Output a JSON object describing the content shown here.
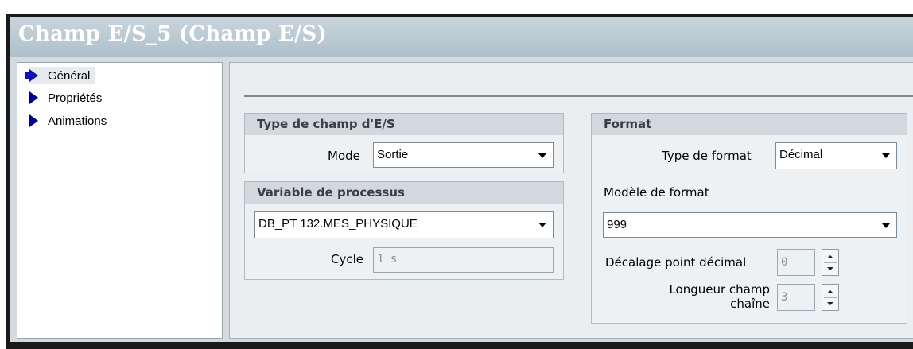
{
  "window": {
    "title": "Champ E/S_5 (Champ E/S)"
  },
  "sidebar": {
    "items": [
      {
        "label": "Général",
        "active": true
      },
      {
        "label": "Propriétés",
        "active": false
      },
      {
        "label": "Animations",
        "active": false
      }
    ]
  },
  "type_group": {
    "title": "Type de champ d'E/S",
    "mode_label": "Mode",
    "mode_value": "Sortie"
  },
  "variable_group": {
    "title": "Variable de processus",
    "variable_value": "DB_PT 132.MES_PHYSIQUE",
    "cycle_label": "Cycle",
    "cycle_value": "1 s"
  },
  "format_group": {
    "title": "Format",
    "type_label": "Type de format",
    "type_value": "Décimal",
    "model_label": "Modèle de format",
    "model_value": "999",
    "decimal_shift_label": "Décalage point décimal",
    "decimal_shift_value": "0",
    "string_length_label_line1": "Longueur champ",
    "string_length_label_line2": "chaîne",
    "string_length_value": "3"
  },
  "colors": {
    "title_bar": "#b9c8d1",
    "nav_icon": "#00008b",
    "panel_bg": "#eaeef1"
  }
}
